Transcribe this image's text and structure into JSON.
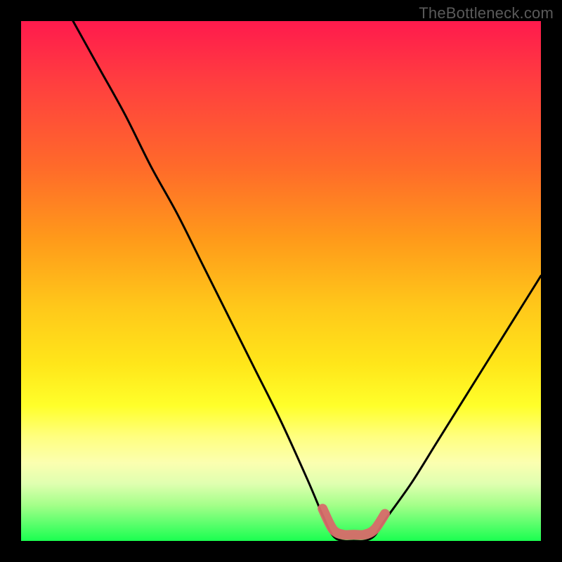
{
  "watermark": "TheBottleneck.com",
  "colors": {
    "frame": "#000000",
    "curve": "#000000",
    "marker": "#d86a6a",
    "gradient_top": "#ff1a4d",
    "gradient_bottom": "#1aff50"
  },
  "chart_data": {
    "type": "line",
    "title": "",
    "xlabel": "",
    "ylabel": "",
    "xlim": [
      0,
      100
    ],
    "ylim": [
      0,
      100
    ],
    "grid": false,
    "series": [
      {
        "name": "bottleneck-curve",
        "x": [
          10,
          15,
          20,
          25,
          30,
          35,
          40,
          45,
          50,
          55,
          58,
          60,
          62,
          64,
          66,
          68,
          70,
          75,
          80,
          85,
          90,
          95,
          100
        ],
        "values": [
          100,
          91,
          82,
          72,
          63,
          53,
          43,
          33,
          23,
          12,
          5,
          1,
          0,
          0,
          0,
          1,
          4,
          11,
          19,
          27,
          35,
          43,
          51
        ]
      }
    ],
    "annotations": [
      {
        "name": "optimal-range-marker",
        "x_start": 58,
        "x_end": 70,
        "y_level": 0,
        "style": "thick-rounded"
      }
    ]
  }
}
